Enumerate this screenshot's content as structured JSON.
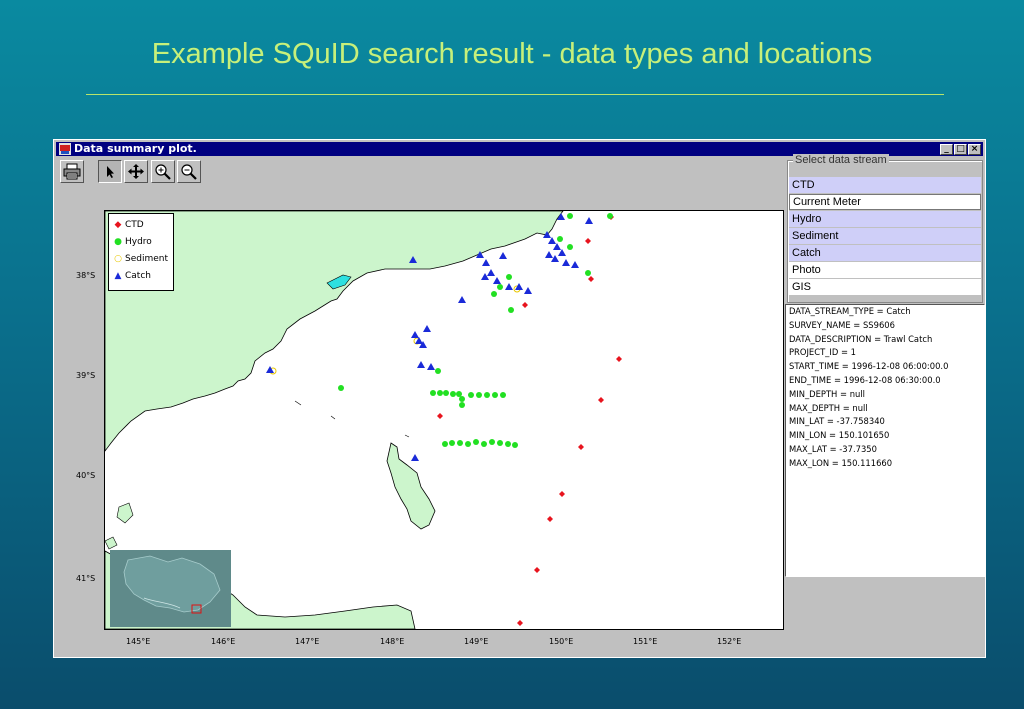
{
  "slide": {
    "title": "Example SQuID search result - data types and locations"
  },
  "window": {
    "title": "Data summary plot.",
    "controls": {
      "minimize": "_",
      "maximize": "□",
      "close": "×"
    }
  },
  "toolbar": {
    "buttons": [
      {
        "name": "print-button",
        "icon": "printer-icon"
      },
      {
        "name": "select-tool-button",
        "icon": "arrow-pointer-icon",
        "active": true
      },
      {
        "name": "pan-tool-button",
        "icon": "move-icon"
      },
      {
        "name": "zoom-in-button",
        "icon": "zoom-in-icon"
      },
      {
        "name": "zoom-out-button",
        "icon": "zoom-out-icon"
      }
    ]
  },
  "map": {
    "y_ticks": [
      "38°S",
      "39°S",
      "40°S",
      "41°S"
    ],
    "x_ticks": [
      "145°E",
      "146°E",
      "147°E",
      "148°E",
      "149°E",
      "150°E",
      "151°E",
      "152°E"
    ],
    "colors": {
      "land": "#ccf5cc",
      "ctd": "#e8141e",
      "hydro": "#22e022",
      "sediment": "#e8c800",
      "catch": "#1a2ad8",
      "lake": "#2ee0e0"
    },
    "legend": [
      {
        "label": "CTD",
        "symbol": "diamond"
      },
      {
        "label": "Hydro",
        "symbol": "circle"
      },
      {
        "label": "Sediment",
        "symbol": "open-circle"
      },
      {
        "label": "Catch",
        "symbol": "triangle"
      }
    ]
  },
  "data_stream": {
    "caption": "Select data stream",
    "items": [
      {
        "label": "CTD",
        "selected": true
      },
      {
        "label": "Current Meter",
        "selected": false,
        "focused": true
      },
      {
        "label": "Hydro",
        "selected": true
      },
      {
        "label": "Sediment",
        "selected": true
      },
      {
        "label": "Catch",
        "selected": true
      },
      {
        "label": "Photo",
        "selected": false
      },
      {
        "label": "GIS",
        "selected": false
      }
    ]
  },
  "info": {
    "lines": [
      "DATA_STREAM_TYPE = Catch",
      "SURVEY_NAME = SS9606",
      "DATA_DESCRIPTION = Trawl Catch",
      "PROJECT_ID = 1",
      "START_TIME = 1996-12-08 06:00:00.0",
      "END_TIME = 1996-12-08 06:30:00.0",
      "MIN_DEPTH = null",
      "MAX_DEPTH = null",
      "MIN_LAT = -37.758340",
      "MIN_LON = 150.101650",
      "MAX_LAT = -37.7350",
      "MAX_LON = 150.111660"
    ]
  }
}
